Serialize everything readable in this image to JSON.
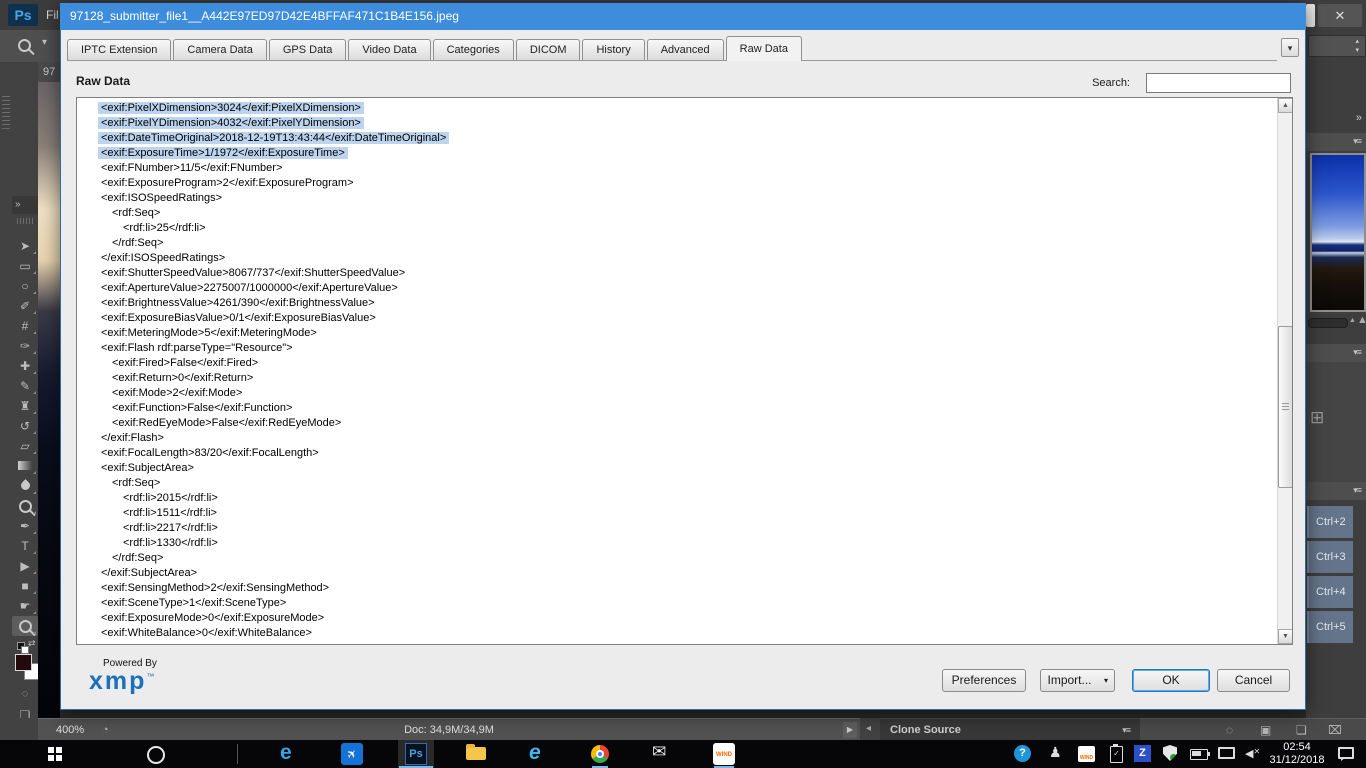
{
  "window": {
    "title": "97128_submitter_file1__A442E97ED97D42E4BFFAF471C1B4E156.jpeg",
    "close_glyph": "✕"
  },
  "photoshop": {
    "logo": "Ps",
    "menu_partial": "Fil",
    "doc_tab_partial": "97",
    "tools": [
      {
        "name": "move-tool",
        "glyph": "➤"
      },
      {
        "name": "marquee-tool",
        "glyph": "▭"
      },
      {
        "name": "lasso-tool",
        "glyph": "○"
      },
      {
        "name": "quick-selection-tool",
        "glyph": "✐"
      },
      {
        "name": "crop-tool",
        "glyph": "#"
      },
      {
        "name": "eyedropper-tool",
        "glyph": "✑"
      },
      {
        "name": "healing-brush-tool",
        "glyph": "✚"
      },
      {
        "name": "brush-tool",
        "glyph": "✎"
      },
      {
        "name": "clone-stamp-tool",
        "glyph": "♜"
      },
      {
        "name": "history-brush-tool",
        "glyph": "↺"
      },
      {
        "name": "eraser-tool",
        "glyph": "▱"
      },
      {
        "name": "gradient-tool",
        "icon": "gradient"
      },
      {
        "name": "blur-tool",
        "icon": "drop"
      },
      {
        "name": "dodge-tool",
        "icon": "magnifier"
      },
      {
        "name": "pen-tool",
        "glyph": "✒"
      },
      {
        "name": "type-tool",
        "glyph": "T"
      },
      {
        "name": "path-selection-tool",
        "glyph": "▶"
      },
      {
        "name": "shape-tool",
        "glyph": "■"
      },
      {
        "name": "hand-tool",
        "glyph": "☛"
      },
      {
        "name": "zoom-tool",
        "icon": "magnifier",
        "active": true
      }
    ],
    "status": {
      "zoom_level": "400%",
      "doc_size": "Doc: 34,9M/34,9M"
    },
    "clone_source_label": "Clone Source",
    "channel_shortcuts": [
      "Ctrl+2",
      "Ctrl+3",
      "Ctrl+4",
      "Ctrl+5"
    ]
  },
  "icons": {
    "collapse": "»",
    "panel_menu": "▾≡",
    "caret_down": "▾",
    "combo_up": "▴",
    "combo_down": "▾",
    "play": "▶",
    "back": "◂",
    "up": "▲",
    "down": "▼",
    "grid": "⊞",
    "mountain_small": "▲",
    "mountain_big": "▲",
    "swap": "⇄",
    "quick_mask": "◌",
    "screen_mode": "❏",
    "dashed_selection": "◌",
    "mask": "▣",
    "new_item": "❏",
    "trash": "⌧",
    "status_clock": "◔",
    "envelope": "✉",
    "plane": "✈",
    "volume": "◀",
    "mute_x": "✕",
    "usb_check": "✓"
  },
  "dialog": {
    "tabs": [
      "IPTC Extension",
      "Camera Data",
      "GPS Data",
      "Video Data",
      "Categories",
      "DICOM",
      "History",
      "Advanced",
      "Raw Data"
    ],
    "active_tab": "Raw Data",
    "heading": "Raw Data",
    "search_label": "Search:",
    "search_value": "",
    "raw_lines": [
      {
        "t": "<exif:PixelXDimension>3024</exif:PixelXDimension>",
        "lvl": 1,
        "hl": true
      },
      {
        "t": "<exif:PixelYDimension>4032</exif:PixelYDimension>",
        "lvl": 1,
        "hl": true
      },
      {
        "t": "<exif:DateTimeOriginal>2018-12-19T13:43:44</exif:DateTimeOriginal>",
        "lvl": 1,
        "hl": true
      },
      {
        "t": "<exif:ExposureTime>1/1972</exif:ExposureTime>",
        "lvl": 1,
        "hl": true
      },
      {
        "t": "<exif:FNumber>11/5</exif:FNumber>",
        "lvl": 1,
        "hl": false
      },
      {
        "t": "<exif:ExposureProgram>2</exif:ExposureProgram>",
        "lvl": 1,
        "hl": false
      },
      {
        "t": "<exif:ISOSpeedRatings>",
        "lvl": 1,
        "hl": false
      },
      {
        "t": "<rdf:Seq>",
        "lvl": 2,
        "hl": false
      },
      {
        "t": "<rdf:li>25</rdf:li>",
        "lvl": 3,
        "hl": false
      },
      {
        "t": "</rdf:Seq>",
        "lvl": 2,
        "hl": false
      },
      {
        "t": "</exif:ISOSpeedRatings>",
        "lvl": 1,
        "hl": false
      },
      {
        "t": "<exif:ShutterSpeedValue>8067/737</exif:ShutterSpeedValue>",
        "lvl": 1,
        "hl": false
      },
      {
        "t": "<exif:ApertureValue>2275007/1000000</exif:ApertureValue>",
        "lvl": 1,
        "hl": false
      },
      {
        "t": "<exif:BrightnessValue>4261/390</exif:BrightnessValue>",
        "lvl": 1,
        "hl": false
      },
      {
        "t": "<exif:ExposureBiasValue>0/1</exif:ExposureBiasValue>",
        "lvl": 1,
        "hl": false
      },
      {
        "t": "<exif:MeteringMode>5</exif:MeteringMode>",
        "lvl": 1,
        "hl": false
      },
      {
        "t": "<exif:Flash rdf:parseType=\"Resource\">",
        "lvl": 1,
        "hl": false
      },
      {
        "t": "<exif:Fired>False</exif:Fired>",
        "lvl": 2,
        "hl": false
      },
      {
        "t": "<exif:Return>0</exif:Return>",
        "lvl": 2,
        "hl": false
      },
      {
        "t": "<exif:Mode>2</exif:Mode>",
        "lvl": 2,
        "hl": false
      },
      {
        "t": "<exif:Function>False</exif:Function>",
        "lvl": 2,
        "hl": false
      },
      {
        "t": "<exif:RedEyeMode>False</exif:RedEyeMode>",
        "lvl": 2,
        "hl": false
      },
      {
        "t": "</exif:Flash>",
        "lvl": 1,
        "hl": false
      },
      {
        "t": "<exif:FocalLength>83/20</exif:FocalLength>",
        "lvl": 1,
        "hl": false
      },
      {
        "t": "<exif:SubjectArea>",
        "lvl": 1,
        "hl": false
      },
      {
        "t": "<rdf:Seq>",
        "lvl": 2,
        "hl": false
      },
      {
        "t": "<rdf:li>2015</rdf:li>",
        "lvl": 3,
        "hl": false
      },
      {
        "t": "<rdf:li>1511</rdf:li>",
        "lvl": 3,
        "hl": false
      },
      {
        "t": "<rdf:li>2217</rdf:li>",
        "lvl": 3,
        "hl": false
      },
      {
        "t": "<rdf:li>1330</rdf:li>",
        "lvl": 3,
        "hl": false
      },
      {
        "t": "</rdf:Seq>",
        "lvl": 2,
        "hl": false
      },
      {
        "t": "</exif:SubjectArea>",
        "lvl": 1,
        "hl": false
      },
      {
        "t": "<exif:SensingMethod>2</exif:SensingMethod>",
        "lvl": 1,
        "hl": false
      },
      {
        "t": "<exif:SceneType>1</exif:SceneType>",
        "lvl": 1,
        "hl": false
      },
      {
        "t": "<exif:ExposureMode>0</exif:ExposureMode>",
        "lvl": 1,
        "hl": false
      },
      {
        "t": "<exif:WhiteBalance>0</exif:WhiteBalance>",
        "lvl": 1,
        "hl": false
      }
    ],
    "footer": {
      "powered_by": "Powered By",
      "xmp": "xmp",
      "tm": "™"
    },
    "buttons": {
      "preferences": "Preferences",
      "import": "Import...",
      "ok": "OK",
      "cancel": "Cancel"
    }
  },
  "taskbar": {
    "glyphs": {
      "edge": "e",
      "ie": "e",
      "ps": "Ps",
      "wind": "WIND",
      "zonealarm": "Z",
      "help": "?"
    },
    "clock_time": "02:54",
    "clock_date": "31/12/2018"
  },
  "colors": {
    "title_bar": "#3e8ddc",
    "selection_highlight": "#bdd4ee",
    "xmp_blue": "#1b72b8",
    "taskbar_underline": "#76b9ed",
    "channel_row": "#64748a"
  }
}
